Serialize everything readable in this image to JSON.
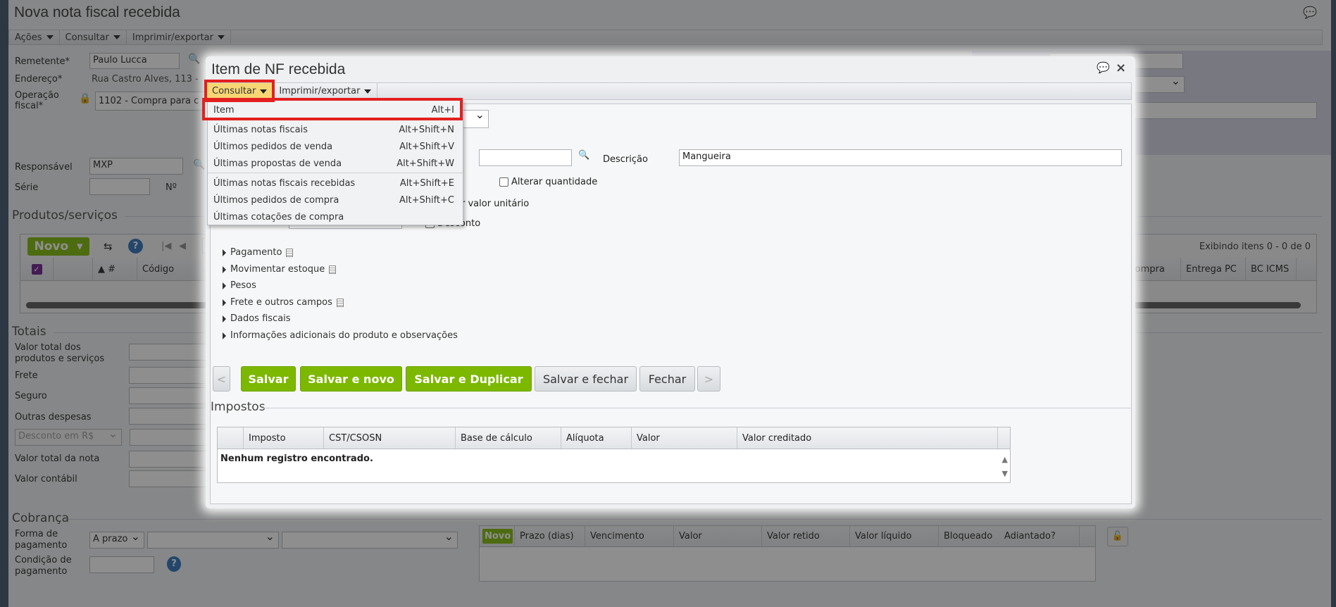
{
  "main": {
    "title": "Nova nota fiscal recebida",
    "toolbar": [
      "Ações",
      "Consultar",
      "Imprimir/exportar"
    ],
    "remetente_label": "Remetente*",
    "remetente_value": "Paulo Lucca",
    "endereco_label": "Endereço*",
    "endereco_value": "Rua Castro Alves, 113 -",
    "operacao_label1": "Operação",
    "operacao_label2": "fiscal*",
    "operacao_value": "1102 - Compra para c",
    "responsavel_label": "Responsável",
    "responsavel_value": "MXP",
    "serie_label": "Série",
    "numero_label": "Nº",
    "produtos_legend": "Produtos/serviços",
    "grid": {
      "novo_label": "Novo",
      "page_size": "20",
      "paging_info": "Exibindo itens 0 - 0 de 0",
      "columns_left": [
        "▲ #",
        "Código"
      ],
      "columns_right": [
        "o de compra",
        "Entrega PC",
        "BC ICMS"
      ]
    },
    "totais_legend": "Totais",
    "totais": {
      "l1a": "Valor total dos",
      "l1b": "produtos e serviços",
      "frete": "Frete",
      "seguro": "Seguro",
      "outras": "Outras despesas",
      "desconto_select": "Desconto em R$",
      "valor_nota": "Valor total da nota",
      "valor_contabil": "Valor contábil"
    },
    "cobranca_legend": "Cobrança",
    "cobranca": {
      "forma1": "Forma de",
      "forma2": "pagamento",
      "forma_value": "A prazo",
      "cond1": "Condição de",
      "cond2": "pagamento",
      "novo_label": "Novo",
      "columns": [
        "Prazo (dias)",
        "Vencimento",
        "Valor",
        "Valor retido",
        "Valor líquido",
        "Bloqueado",
        "Adiantado?"
      ]
    }
  },
  "modal": {
    "title": "Item de NF recebida",
    "toolbar": {
      "consultar": "Consultar",
      "imprimir": "Imprimir/exportar"
    },
    "menu": [
      {
        "label": "Item",
        "shortcut": "Alt+I"
      },
      {
        "label": "Últimas notas fiscais",
        "shortcut": "Alt+Shift+N"
      },
      {
        "label": "Últimos pedidos de venda",
        "shortcut": "Alt+Shift+V"
      },
      {
        "label": "Últimas propostas de venda",
        "shortcut": "Alt+Shift+W"
      },
      {
        "label": "Últimas notas fiscais recebidas",
        "shortcut": "Alt+Shift+E"
      },
      {
        "label": "Últimos pedidos de compra",
        "shortcut": "Alt+Shift+C"
      },
      {
        "label": "Últimas cotações de compra",
        "shortcut": ""
      }
    ],
    "form": {
      "codigo_partial": "o",
      "descricao_label": "Descrição",
      "descricao_value": "Mangueira",
      "alterar_quantidade": "Alterar quantidade",
      "valor_unitario_partial": "r valor unitário",
      "desconto_partial": "Desconto"
    },
    "sections": [
      "Pagamento",
      "Movimentar estoque",
      "Pesos",
      "Frete e outros campos",
      "Dados fiscais",
      "Informações adicionais do produto e observações"
    ],
    "buttons": {
      "prev": "<",
      "salvar": "Salvar",
      "salvar_novo": "Salvar e novo",
      "salvar_duplicar": "Salvar e Duplicar",
      "salvar_fechar": "Salvar e fechar",
      "fechar": "Fechar",
      "next": ">"
    },
    "impostos_legend": "Impostos",
    "impostos_columns": [
      "Imposto",
      "CST/CSOSN",
      "Base de cálculo",
      "Alíquota",
      "Valor",
      "Valor creditado"
    ],
    "impostos_empty": "Nenhum registro encontrado."
  },
  "colors": {
    "accent_green": "#7cb800",
    "highlight_yellow": "#f7d774",
    "annotation_red": "#e32020"
  }
}
